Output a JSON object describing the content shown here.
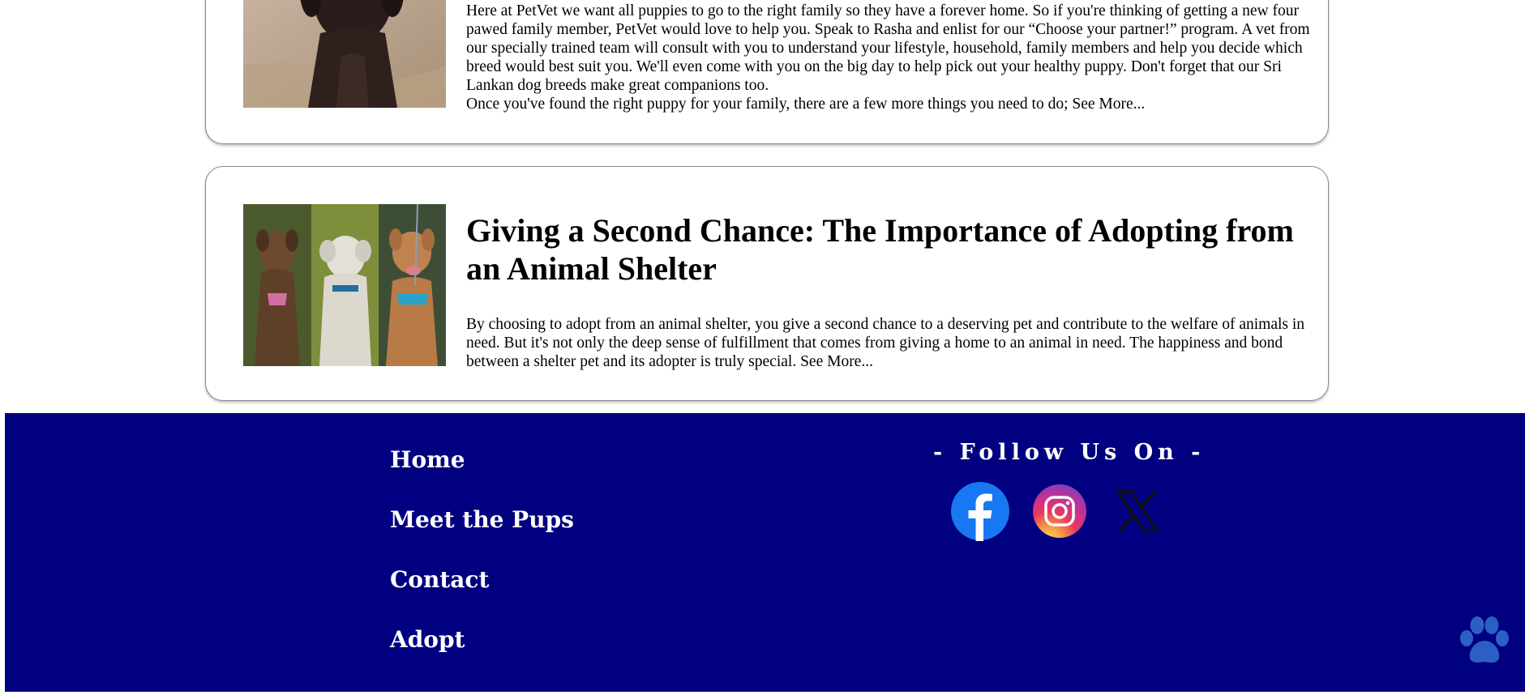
{
  "cards": [
    {
      "paragraphs": [
        "Here at PetVet we want all puppies to go to the right family so they have a forever home. So if you're thinking of getting a new four pawed family member, PetVet would love to help you. Speak to Rasha and enlist for our “Choose your partner!” program. A vet from our specially trained team will consult with you to understand your lifestyle, household, family members and help you decide which breed would best suit you. We'll even come with you on the big day to help pick out your healthy puppy. Don't forget that our Sri Lankan dog breeds make great companions too.",
        "Once you've found the right puppy for your family, there are a few more things you need to do; See More..."
      ]
    },
    {
      "title": "Giving a Second Chance: The Importance of Adopting from an Animal Shelter",
      "paragraphs": [
        "By choosing to adopt from an animal shelter, you give a second chance to a deserving pet and contribute to the welfare of animals in need. But it's not only the deep sense of fulfillment that comes from giving a home to an animal in need. The happiness and bond between a shelter pet and its adopter is truly special. See More..."
      ]
    }
  ],
  "footer": {
    "nav": [
      "Home",
      "Meet the Pups",
      "Contact",
      "Adopt"
    ],
    "follow_heading": "- Follow Us On -",
    "socials": [
      {
        "name": "facebook",
        "icon": "facebook-icon"
      },
      {
        "name": "instagram",
        "icon": "instagram-icon"
      },
      {
        "name": "x",
        "icon": "x-icon"
      }
    ],
    "background_color": "#000080",
    "paw_icon": "paw-icon",
    "paw_color": "#2b5fc4"
  }
}
